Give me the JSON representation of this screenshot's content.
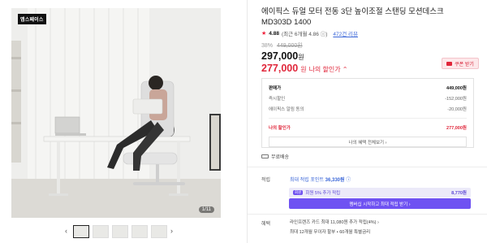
{
  "gallery": {
    "badge": "앱스페이스",
    "counter": "1/11",
    "prev_label": "‹",
    "next_label": "›",
    "thumbnails": 5
  },
  "product": {
    "title": "에이픽스 듀얼 모터 전동 3단 높이조절 스탠딩 모션데스크 MD303D 1400",
    "rating": "4.88",
    "rating_note": "(최근 6개월 4.86 ⓘ)",
    "review_link": "472건 리뷰",
    "discount_pct": "38%",
    "original_price": "449,000원",
    "price": "297,000",
    "price_unit": "원",
    "my_price": "277,000",
    "my_price_unit": "원",
    "my_price_label": "나의 할인가 ⌃",
    "coupon_label": "쿠폰 받기"
  },
  "breakdown": {
    "sale_price_label": "판매가",
    "sale_price": "449,000원",
    "instant_label": "즉시할인",
    "instant": "-152,000원",
    "alarm_label": "에이픽스 알림 동의",
    "alarm": "-20,000원",
    "my_price_label": "나의 할인가",
    "my_price": "277,000원",
    "benefit_button": "나의 혜택 전체보기 ›"
  },
  "shipping": {
    "label": "무료배송"
  },
  "points": {
    "label": "적립",
    "value_prefix": "최대 적립 포인트",
    "value": "36,330원",
    "member_tag": "회원",
    "member_text": "회원 5% 추가 적립",
    "member_value": "8,770원",
    "button": "멤버십 시작하고 최대 적립 받기 ›"
  },
  "benefits": {
    "label": "혜택",
    "line1": "라인프렌즈 카드 최대 11,080원 추가 적립(4%) ›",
    "line2": "최대 12개월 무이자 할부 • 60개월 특별금리"
  },
  "colors": {
    "accent_red": "#e0263a",
    "accent_purple": "#6f52f2",
    "link_blue": "#3a66d8"
  }
}
